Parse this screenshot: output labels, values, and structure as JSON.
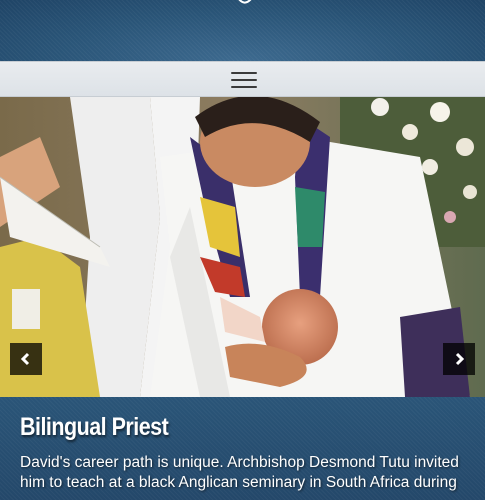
{
  "menu": {
    "icon": "hamburger-menu-icon"
  },
  "carousel": {
    "prev_icon": "chevron-left-icon",
    "next_icon": "chevron-right-icon",
    "slide": {
      "title": "Bilingual Priest",
      "text": "David's career path is unique. Archbishop Desmond Tutu invited him to teach at a black Anglican seminary in South Africa during"
    }
  },
  "colors": {
    "header_bg": "#2a5578",
    "navbar_bg": "#e4e8ec",
    "arrow_bg": "#000000",
    "caption_text": "#ffffff"
  }
}
